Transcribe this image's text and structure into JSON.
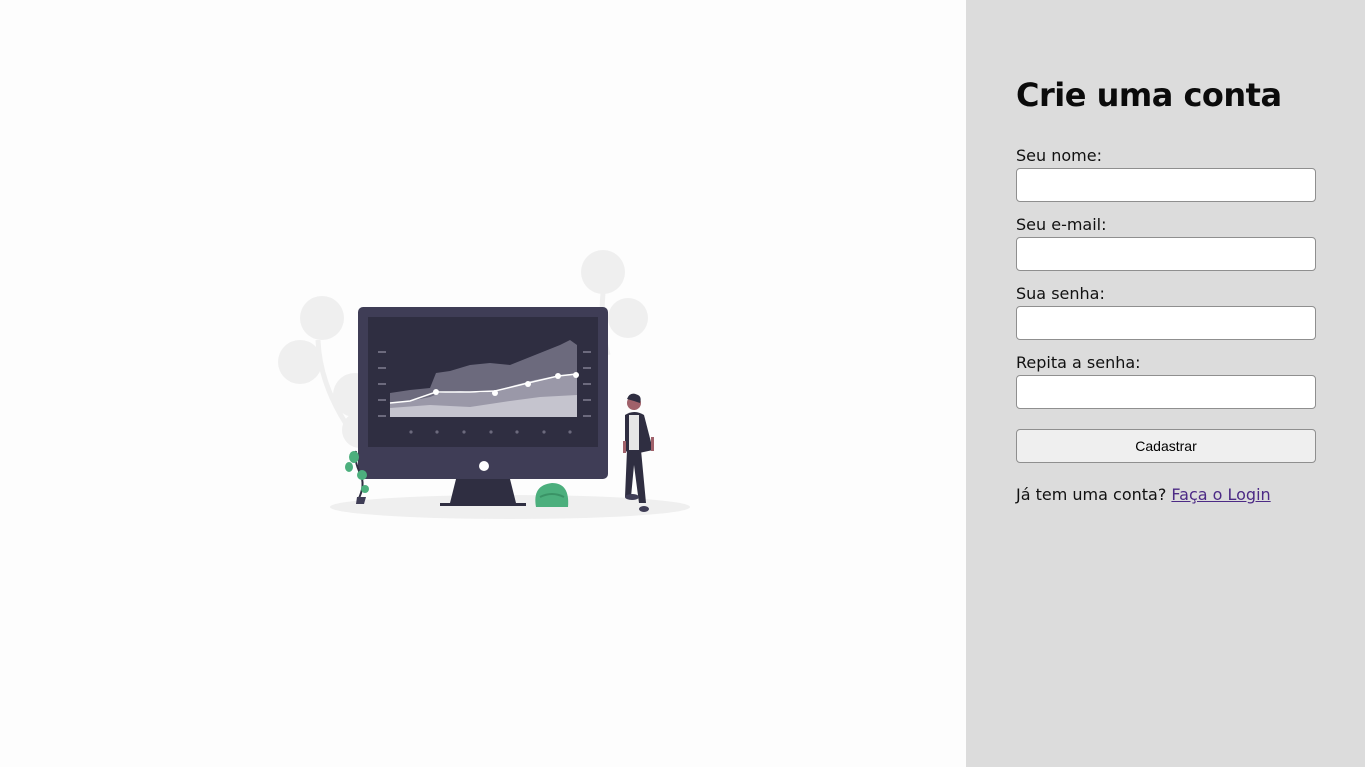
{
  "form": {
    "title": "Crie uma conta",
    "fields": [
      {
        "label": "Seu nome:",
        "value": "",
        "type": "text"
      },
      {
        "label": "Seu e-mail:",
        "value": "",
        "type": "email"
      },
      {
        "label": "Sua senha:",
        "value": "",
        "type": "password"
      },
      {
        "label": "Repita a senha:",
        "value": "",
        "type": "password"
      }
    ],
    "submit_label": "Cadastrar",
    "login_prompt": "Já tem uma conta?",
    "login_link": "Faça o Login"
  },
  "colors": {
    "right_panel_bg": "#dcdcdc",
    "monitor": "#3f3d56",
    "accent_green": "#4caf7d",
    "link": "#4c2a85"
  },
  "illustration": {
    "name": "data-dashboard-illustration"
  }
}
